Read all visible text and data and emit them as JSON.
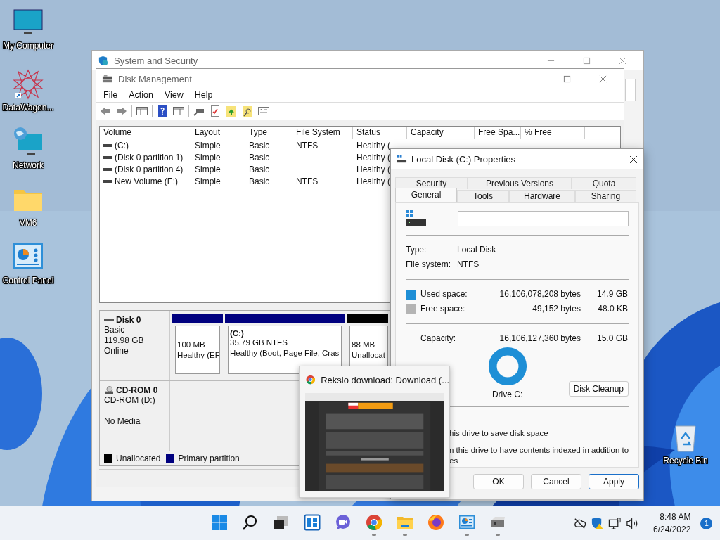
{
  "desktop_icons": [
    {
      "label": "My Computer",
      "kind": "monitor"
    },
    {
      "label": "DataWagon...",
      "kind": "starburst"
    },
    {
      "label": "Network",
      "kind": "network"
    },
    {
      "label": "VM6",
      "kind": "folder"
    },
    {
      "label": "Control Panel",
      "kind": "control-panel"
    }
  ],
  "recycle_bin": {
    "label": "Recycle Bin"
  },
  "system_window": {
    "title": "System and Security"
  },
  "disk_management": {
    "title": "Disk Management",
    "menu": [
      "File",
      "Action",
      "View",
      "Help"
    ],
    "columns": [
      "Volume",
      "Layout",
      "Type",
      "File System",
      "Status",
      "Capacity",
      "Free Spa...",
      "% Free"
    ],
    "rows": [
      [
        "(C:)",
        "Simple",
        "Basic",
        "NTFS",
        "Healthy ("
      ],
      [
        "(Disk 0 partition 1)",
        "Simple",
        "Basic",
        "",
        "Healthy ("
      ],
      [
        "(Disk 0 partition 4)",
        "Simple",
        "Basic",
        "",
        "Healthy ("
      ],
      [
        "New Volume (E:)",
        "Simple",
        "Basic",
        "NTFS",
        "Healthy ("
      ]
    ],
    "disks": [
      {
        "name": "Disk 0",
        "kind": "disk",
        "lines": [
          "Basic",
          "119.98 GB",
          "Online"
        ],
        "partitions": [
          {
            "kind": "primary",
            "lines": [
              "100 MB",
              "Healthy (EF"
            ]
          },
          {
            "kind": "primary",
            "title": "(C:)",
            "lines": [
              "35.79 GB NTFS",
              "Healthy (Boot, Page File, Cras"
            ]
          },
          {
            "kind": "unallocated",
            "lines": [
              "88 MB",
              "Unallocat"
            ]
          }
        ]
      },
      {
        "name": "CD-ROM 0",
        "kind": "cdrom",
        "lines": [
          "CD-ROM (D:)"
        ],
        "media": "No Media"
      }
    ],
    "legend": [
      {
        "label": "Unallocated",
        "color": "#000000"
      },
      {
        "label": "Primary partition",
        "color": "#00007f"
      }
    ]
  },
  "properties": {
    "title": "Local Disk (C:) Properties",
    "tabs_top": [
      {
        "label": "Security",
        "selected": false
      },
      {
        "label": "Previous Versions",
        "selected": false
      },
      {
        "label": "Quota",
        "selected": false
      }
    ],
    "tabs": [
      {
        "label": "General",
        "selected": true
      },
      {
        "label": "Tools",
        "selected": false
      },
      {
        "label": "Hardware",
        "selected": false
      },
      {
        "label": "Sharing",
        "selected": false
      }
    ],
    "type_label": "Type:",
    "type": "Local Disk",
    "fs_label": "File system:",
    "fs": "NTFS",
    "space": [
      {
        "label": "Used space:",
        "bytes": "16,106,078,208 bytes",
        "size": "14.9 GB",
        "color": "#1e8fd6"
      },
      {
        "label": "Free space:",
        "bytes": "49,152 bytes",
        "size": "48.0 KB",
        "color": "#b4b4b4"
      }
    ],
    "capacity": {
      "label": "Capacity:",
      "bytes": "16,106,127,360 bytes",
      "size": "15.0 GB"
    },
    "drive_label": "Drive C:",
    "cleanup": "Disk Cleanup",
    "options": [
      "his drive to save disk space",
      "n this drive to have contents indexed in addition to",
      "es"
    ],
    "buttons": [
      {
        "label": "OK",
        "default": false
      },
      {
        "label": "Cancel",
        "default": false
      },
      {
        "label": "Apply",
        "default": true
      }
    ]
  },
  "preview": {
    "title": "Reksio download: Download (..."
  },
  "taskbar": {
    "apps": [
      {
        "kind": "start",
        "running": false
      },
      {
        "kind": "search",
        "running": false
      },
      {
        "kind": "task-view",
        "running": false
      },
      {
        "kind": "widgets",
        "running": false
      },
      {
        "kind": "chat",
        "running": false
      },
      {
        "kind": "chrome",
        "running": true
      },
      {
        "kind": "explorer",
        "running": true
      },
      {
        "kind": "firefox",
        "running": false
      },
      {
        "kind": "control-panel",
        "running": true
      },
      {
        "kind": "drive-tool",
        "running": true
      }
    ],
    "time": "8:48 AM",
    "date": "6/24/2022",
    "notifications": "1"
  }
}
